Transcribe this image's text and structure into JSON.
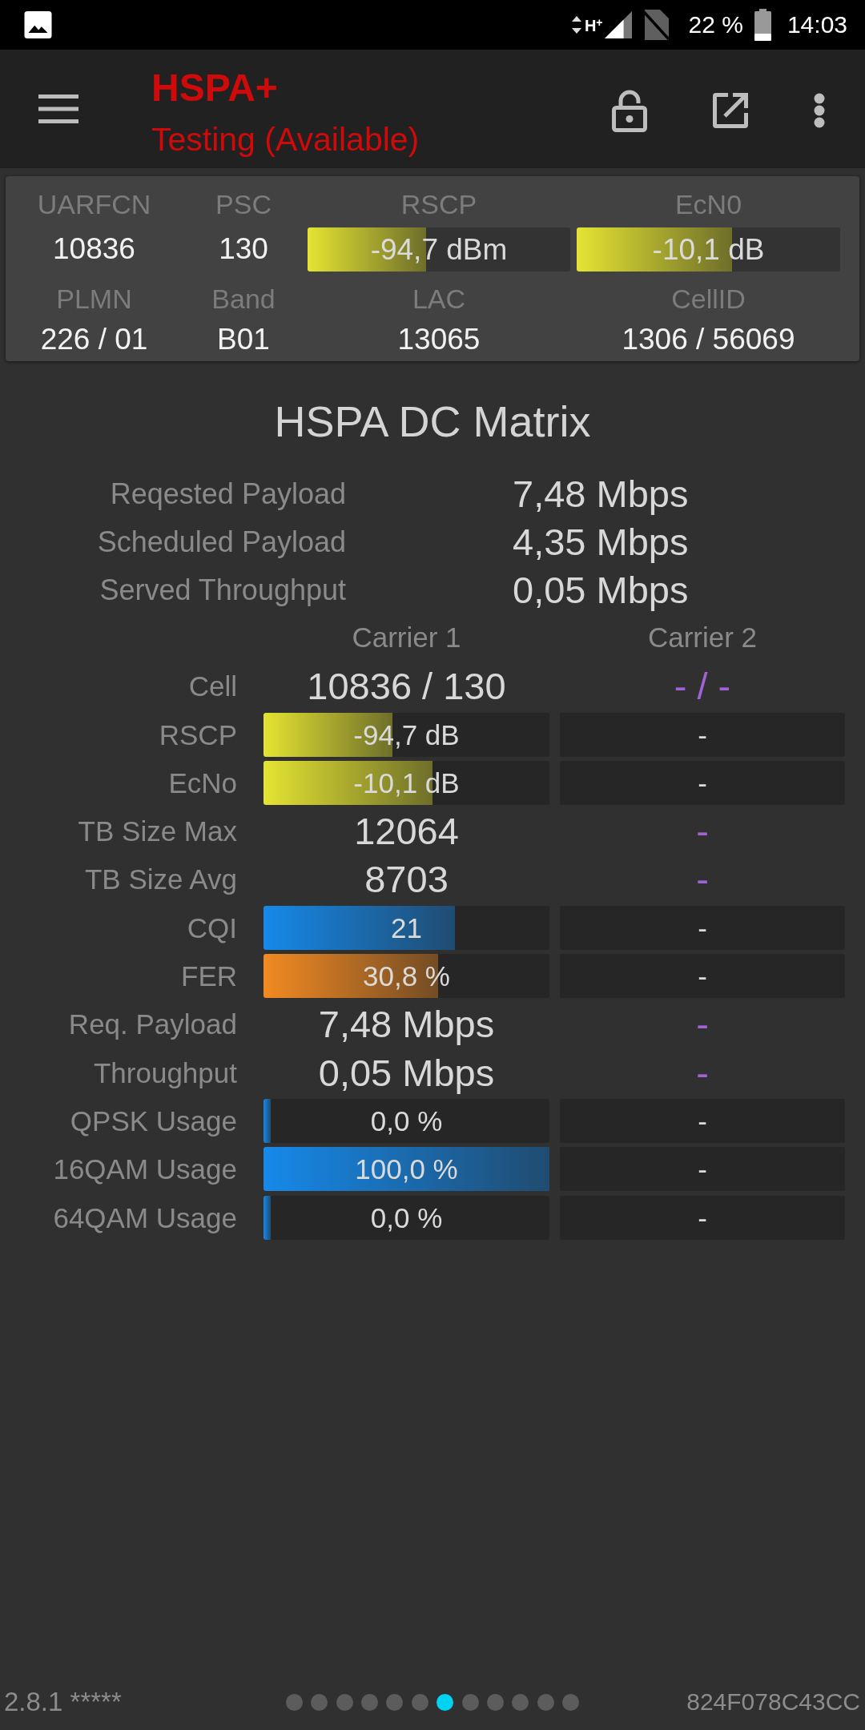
{
  "status_bar": {
    "network": "H$^{+}$",
    "battery": "22 %",
    "time": "14:03"
  },
  "toolbar": {
    "title": "HSPA+",
    "subtitle": "Testing (Available)"
  },
  "cell_info": {
    "fields": [
      {
        "label": "UARFCN",
        "kind": "text",
        "value": "10836"
      },
      {
        "label": "PSC",
        "kind": "text",
        "value": "130"
      },
      {
        "label": "RSCP",
        "kind": "bar",
        "value": "-94,7 dBm",
        "level": 0.45,
        "color": "#e4e432"
      },
      {
        "label": "EcN0",
        "kind": "bar",
        "value": "-10,1 dB",
        "level": 0.59,
        "color": "#e4e432"
      },
      {
        "label": "PLMN",
        "kind": "text",
        "value": "226 / 01"
      },
      {
        "label": "Band",
        "kind": "text",
        "value": "B01"
      },
      {
        "label": "LAC",
        "kind": "text",
        "value": "13065"
      },
      {
        "label": "CellID",
        "kind": "text",
        "value": "1306 / 56069"
      }
    ]
  },
  "matrix": {
    "title": "HSPA DC Matrix",
    "summary": [
      {
        "label": "Reqested Payload",
        "value": "7,48 Mbps"
      },
      {
        "label": "Scheduled Payload",
        "value": "4,35 Mbps"
      },
      {
        "label": "Served Throughput",
        "value": "0,05 Mbps"
      }
    ],
    "carriers": [
      "Carrier 1",
      "Carrier 2"
    ],
    "rows": [
      {
        "label": "Cell",
        "kind": "text",
        "cells": [
          {
            "text": "10836 / 130"
          },
          {
            "text": "- / -",
            "color": "#a261d4"
          }
        ]
      },
      {
        "label": "RSCP",
        "kind": "bar",
        "cells": [
          {
            "text": "-94,7 dB",
            "level": 0.45,
            "color": "#e4e432"
          },
          {
            "text": "-"
          }
        ]
      },
      {
        "label": "EcNo",
        "kind": "bar",
        "cells": [
          {
            "text": "-10,1 dB",
            "level": 0.59,
            "color": "#e4e432"
          },
          {
            "text": "-"
          }
        ]
      },
      {
        "label": "TB Size Max",
        "kind": "text",
        "cells": [
          {
            "text": "12064"
          },
          {
            "text": "-",
            "color": "#a261d4"
          }
        ]
      },
      {
        "label": "TB Size Avg",
        "kind": "text",
        "cells": [
          {
            "text": "8703"
          },
          {
            "text": "-",
            "color": "#a261d4"
          }
        ]
      },
      {
        "label": "CQI",
        "kind": "bar",
        "cells": [
          {
            "text": "21",
            "level": 0.67,
            "color": "#1689ea"
          },
          {
            "text": "-"
          }
        ]
      },
      {
        "label": "FER",
        "kind": "bar",
        "cells": [
          {
            "text": "30,8 %",
            "level": 0.61,
            "color": "#f28a22"
          },
          {
            "text": "-"
          }
        ]
      },
      {
        "label": "Req. Payload",
        "kind": "text",
        "cells": [
          {
            "text": "7,48 Mbps"
          },
          {
            "text": "-",
            "color": "#a261d4"
          }
        ]
      },
      {
        "label": "Throughput",
        "kind": "text",
        "cells": [
          {
            "text": "0,05 Mbps"
          },
          {
            "text": "-",
            "color": "#a261d4"
          }
        ]
      },
      {
        "label": "QPSK Usage",
        "kind": "bar",
        "cells": [
          {
            "text": "0,0 %",
            "level": 0.025,
            "color": "#1689ea"
          },
          {
            "text": "-"
          }
        ]
      },
      {
        "label": "16QAM Usage",
        "kind": "bar",
        "cells": [
          {
            "text": "100,0 %",
            "level": 1,
            "color": "#1689ea"
          },
          {
            "text": "-"
          }
        ]
      },
      {
        "label": "64QAM Usage",
        "kind": "bar",
        "cells": [
          {
            "text": "0,0 %",
            "level": 0.025,
            "color": "#1689ea"
          },
          {
            "text": "-"
          }
        ]
      }
    ]
  },
  "footer": {
    "version": "2.8.1 *****",
    "pages": [
      {
        "selected": false
      },
      {
        "selected": false
      },
      {
        "selected": false
      },
      {
        "selected": false
      },
      {
        "selected": false
      },
      {
        "selected": false
      },
      {
        "selected": true
      },
      {
        "selected": false
      },
      {
        "selected": false
      },
      {
        "selected": false
      },
      {
        "selected": false
      },
      {
        "selected": false
      }
    ],
    "device_id": "824F078C43CC"
  }
}
